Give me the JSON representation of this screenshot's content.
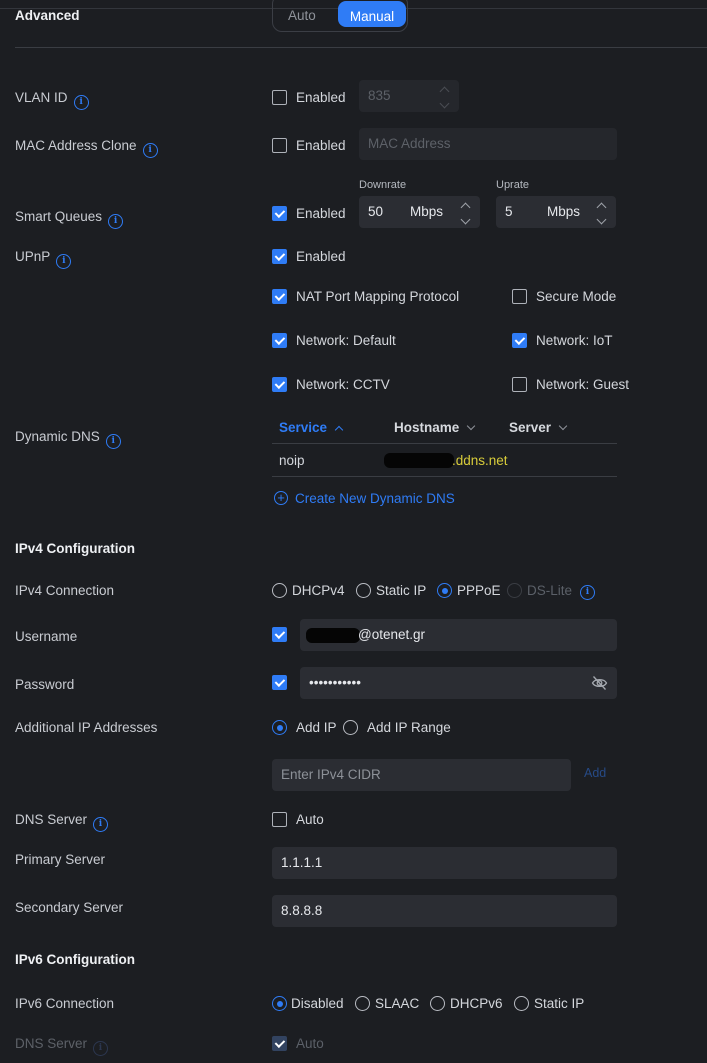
{
  "advanced": {
    "title": "Advanced",
    "mode_toggle": {
      "auto_label": "Auto",
      "manual_label": "Manual",
      "selected": "Manual"
    }
  },
  "vlan": {
    "label": "VLAN ID",
    "enabled_label": "Enabled",
    "enabled": false,
    "value": "835"
  },
  "mac_clone": {
    "label": "MAC Address Clone",
    "enabled_label": "Enabled",
    "enabled": false,
    "placeholder": "MAC Address"
  },
  "smart_queues": {
    "label": "Smart Queues",
    "enabled_label": "Enabled",
    "enabled": true,
    "downrate": {
      "label": "Downrate",
      "value": "50",
      "unit": "Mbps"
    },
    "uprate": {
      "label": "Uprate",
      "value": "5",
      "unit": "Mbps"
    }
  },
  "upnp": {
    "label": "UPnP",
    "enabled_label": "Enabled",
    "enabled": true,
    "options": [
      {
        "label": "NAT Port Mapping Protocol",
        "checked": true
      },
      {
        "label": "Secure Mode",
        "checked": false
      },
      {
        "label": "Network: Default",
        "checked": true
      },
      {
        "label": "Network: IoT",
        "checked": true
      },
      {
        "label": "Network: CCTV",
        "checked": true
      },
      {
        "label": "Network: Guest",
        "checked": false
      }
    ]
  },
  "ddns": {
    "label": "Dynamic DNS",
    "columns": [
      "Service",
      "Hostname",
      "Server"
    ],
    "rows": [
      {
        "service": "noip",
        "hostname": ".ddns.net"
      }
    ],
    "create_label": "Create New Dynamic DNS"
  },
  "ipv4": {
    "title": "IPv4 Configuration",
    "connection_label": "IPv4 Connection",
    "connection_options": [
      "DHCPv4",
      "Static IP",
      "PPPoE",
      "DS-Lite"
    ],
    "connection_selected": "PPPoE",
    "username_label": "Username",
    "username_value": "@otenet.gr",
    "password_label": "Password",
    "password_value": "•••••••••••",
    "additional_ip_label": "Additional IP Addresses",
    "add_ip_label": "Add IP",
    "add_ip_range_label": "Add IP Range",
    "add_mode": "Add IP",
    "cidr_placeholder": "Enter IPv4 CIDR",
    "add_button": "Add",
    "dns_label": "DNS Server",
    "dns_auto_label": "Auto",
    "dns_auto": false,
    "primary_label": "Primary Server",
    "primary_value": "1.1.1.1",
    "secondary_label": "Secondary Server",
    "secondary_value": "8.8.8.8"
  },
  "ipv6": {
    "title": "IPv6 Configuration",
    "connection_label": "IPv6 Connection",
    "connection_options": [
      "Disabled",
      "SLAAC",
      "DHCPv6",
      "Static IP"
    ],
    "connection_selected": "Disabled",
    "dns_label": "DNS Server",
    "dns_auto_label": "Auto",
    "dns_auto": true
  },
  "colors": {
    "accent": "#2f7cf6",
    "background": "#1c1e22",
    "input": "#2b2d33"
  }
}
